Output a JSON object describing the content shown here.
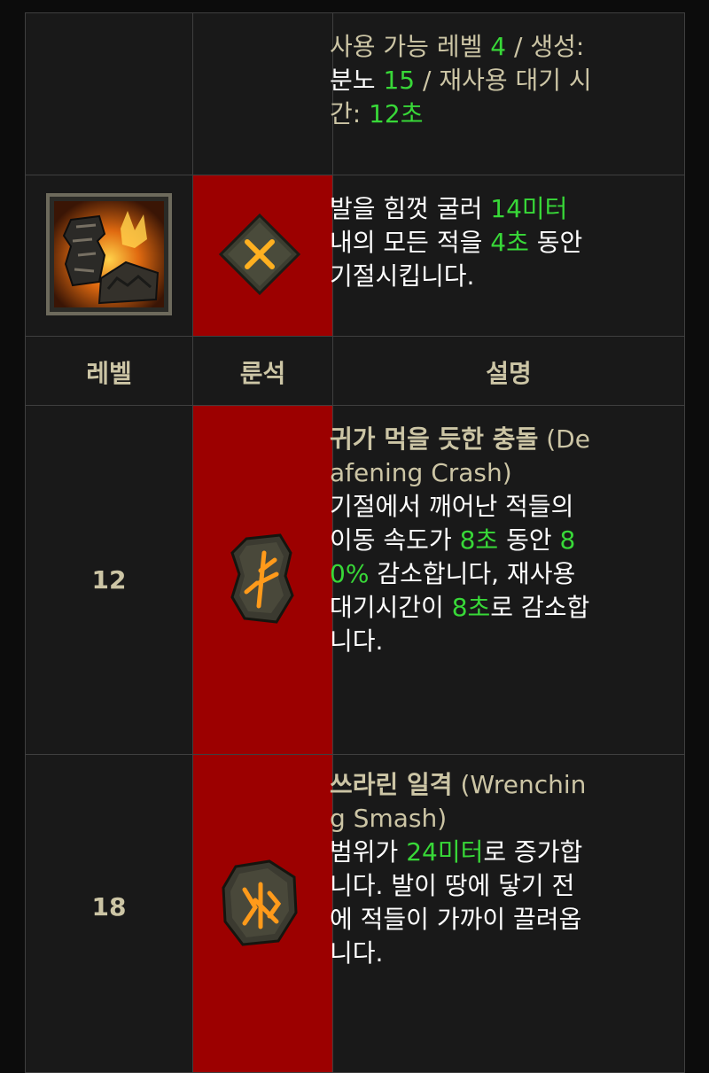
{
  "skill": {
    "req_label": "사용 가능 레벨",
    "req_level": "4",
    "sep1": " / 생성:",
    "gen_label": "분노",
    "gen_value": "15",
    "sep2": " / 재사용 대기 시",
    "cd_label": "간:",
    "cd_value": "12초",
    "icon": "stomp-skill-icon",
    "rune_icon": "x-rune-icon",
    "desc": {
      "t1": "발을 힘껏 굴러",
      "v1": "14미터",
      "t2": "내의 모든 적을",
      "v2": "4초",
      "t3": "동안",
      "t4": "기절시킵니다."
    }
  },
  "headers": {
    "level": "레벨",
    "rune": "룬석",
    "desc": "설명"
  },
  "rows": [
    {
      "level": "12",
      "rune_icon": "rune-stone-icon",
      "name": "귀가 먹을 듯한 충돌",
      "eng_a": "(De",
      "eng_b": "afening Crash)",
      "d1": "기절에서 깨어난 적들의",
      "d2a": "이동 속도가",
      "d2v": "8초",
      "d2b": "동안",
      "d2c": "8",
      "d3v": "0%",
      "d3a": "감소합니다, 재사용",
      "d4a": "대기시간이",
      "d4v": "8초",
      "d4b": "로 감소합",
      "d5": "니다."
    },
    {
      "level": "18",
      "rune_icon": "rune-stone-icon",
      "name": "쓰라린 일격",
      "eng_a": "(Wrenchin",
      "eng_b": "g Smash)",
      "d1a": "범위가",
      "d1v": "24미터",
      "d1b": "로 증가합",
      "d2": "니다. 발이 땅에 닿기 전",
      "d3": "에 적들이 가까이 끌려옵",
      "d4": "니다."
    }
  ],
  "colors": {
    "highlight": "#38d838",
    "tan": "#ccc5a5",
    "rune_bg": "#9c0000",
    "cell_bg": "#191919"
  }
}
